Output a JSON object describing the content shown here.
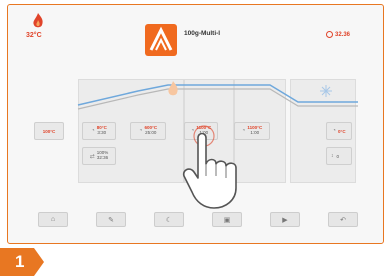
{
  "header": {
    "furnace_temp": "32°C",
    "program_name": "100g-Multi-I",
    "clock_time": "32.36",
    "icons": {
      "furnace": "flame-icon",
      "program": "program-icon",
      "clock": "clock-icon"
    }
  },
  "stages": {
    "standby": {
      "temp": "100°C"
    },
    "heat_rate": {
      "temp": "80°C",
      "time": "3:30"
    },
    "holding": {
      "temp": "600°C",
      "time": "25:00"
    },
    "firing": {
      "temp": "1100°C",
      "time": "1:00"
    },
    "final": {
      "temp": "1100°C",
      "time": "1:00"
    },
    "vacuum": {
      "pct": "100%",
      "time": "32:36"
    },
    "cooling": {
      "temp": "0°C"
    },
    "long_cooling": {
      "label": "0"
    }
  },
  "toolbar": {
    "buttons": [
      {
        "name": "home-button",
        "icon": "home-icon"
      },
      {
        "name": "edit-button",
        "icon": "pencil-icon"
      },
      {
        "name": "night-mode-button",
        "icon": "moon-icon"
      },
      {
        "name": "save-button",
        "icon": "save-icon"
      },
      {
        "name": "play-button",
        "icon": "play-icon"
      },
      {
        "name": "return-button",
        "icon": "return-arrow-icon"
      }
    ]
  },
  "step_badge": {
    "number": "1"
  },
  "colors": {
    "accent": "#e87722",
    "temperature": "#e0442a",
    "curve": "#6fa8dc"
  }
}
